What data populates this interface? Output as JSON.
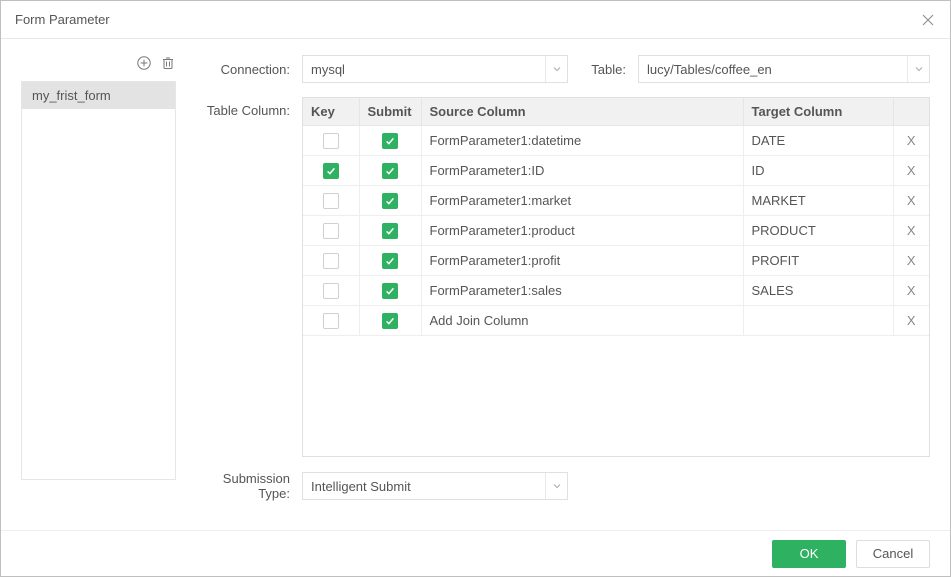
{
  "dialog": {
    "title": "Form Parameter"
  },
  "sidebar": {
    "items": [
      {
        "label": "my_frist_form",
        "selected": true
      }
    ]
  },
  "form": {
    "connection_label": "Connection:",
    "connection_value": "mysql",
    "table_label": "Table:",
    "table_value": "lucy/Tables/coffee_en",
    "table_column_label": "Table Column:",
    "submission_type_label": "Submission Type:",
    "submission_type_value": "Intelligent Submit"
  },
  "table": {
    "headers": {
      "key": "Key",
      "submit": "Submit",
      "source": "Source Column",
      "target": "Target Column",
      "delete": ""
    },
    "rows": [
      {
        "key": false,
        "submit": true,
        "source": "FormParameter1:datetime",
        "target": "DATE",
        "delete": "X"
      },
      {
        "key": true,
        "submit": true,
        "source": "FormParameter1:ID",
        "target": "ID",
        "delete": "X"
      },
      {
        "key": false,
        "submit": true,
        "source": "FormParameter1:market",
        "target": "MARKET",
        "delete": "X"
      },
      {
        "key": false,
        "submit": true,
        "source": "FormParameter1:product",
        "target": "PRODUCT",
        "delete": "X"
      },
      {
        "key": false,
        "submit": true,
        "source": "FormParameter1:profit",
        "target": "PROFIT",
        "delete": "X"
      },
      {
        "key": false,
        "submit": true,
        "source": "FormParameter1:sales",
        "target": "SALES",
        "delete": "X"
      },
      {
        "key": false,
        "submit": true,
        "source": "Add Join Column",
        "target": "",
        "delete": "X"
      }
    ]
  },
  "buttons": {
    "ok": "OK",
    "cancel": "Cancel"
  }
}
